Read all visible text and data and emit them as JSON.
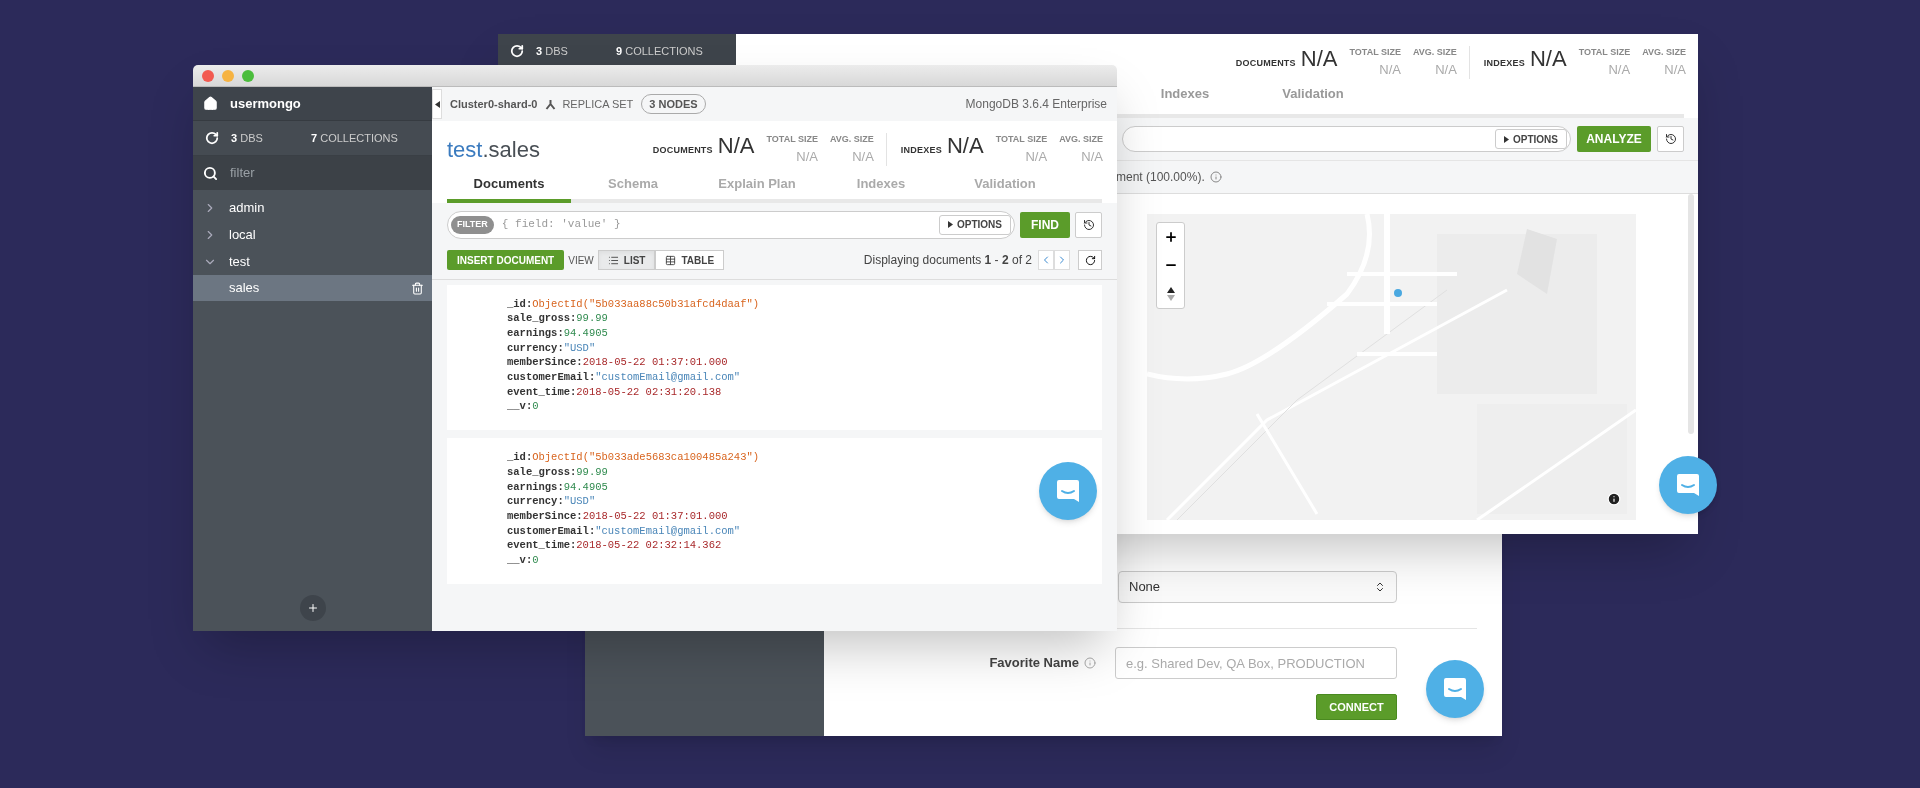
{
  "connect_window": {
    "select": {
      "value": "None"
    },
    "favorite_name": {
      "label": "Favorite Name",
      "placeholder": "e.g. Shared Dev, QA Box, PRODUCTION"
    },
    "connect_button": "CONNECT"
  },
  "stores_window": {
    "sidebar": {
      "dbs": {
        "count": "3",
        "label": "DBS"
      },
      "collections": {
        "count": "9",
        "label": "COLLECTIONS"
      }
    },
    "stats": [
      {
        "label": "DOCUMENTS",
        "value": "N/A",
        "sub": [
          {
            "label": "TOTAL SIZE",
            "value": "N/A"
          },
          {
            "label": "AVG. SIZE",
            "value": "N/A"
          }
        ]
      },
      {
        "label": "INDEXES",
        "value": "N/A",
        "sub": [
          {
            "label": "TOTAL SIZE",
            "value": "N/A"
          },
          {
            "label": "AVG. SIZE",
            "value": "N/A"
          }
        ]
      }
    ],
    "tabs": [
      {
        "label": "Indexes",
        "selected": false
      },
      {
        "label": "Validation",
        "selected": false
      }
    ],
    "options_button": "OPTIONS",
    "analyze_button": "ANALYZE",
    "message": "ment (100.00%)."
  },
  "sales_window": {
    "sidebar": {
      "connection": "usermongo",
      "dbs": {
        "count": "3",
        "label": "DBS"
      },
      "collections": {
        "count": "7",
        "label": "COLLECTIONS"
      },
      "filter_placeholder": "filter",
      "databases": [
        {
          "name": "admin",
          "expanded": false
        },
        {
          "name": "local",
          "expanded": false
        },
        {
          "name": "test",
          "expanded": true,
          "children": [
            {
              "name": "sales",
              "selected": true
            }
          ]
        }
      ]
    },
    "topbar": {
      "cluster": "Cluster0-shard-0",
      "replica_label": "REPLICA SET",
      "nodes": "3 NODES",
      "version": "MongoDB 3.6.4 Enterprise"
    },
    "title": {
      "db": "test",
      "collection": ".sales"
    },
    "stats": [
      {
        "label": "DOCUMENTS",
        "value": "N/A",
        "sub": [
          {
            "label": "TOTAL SIZE",
            "value": "N/A"
          },
          {
            "label": "AVG. SIZE",
            "value": "N/A"
          }
        ]
      },
      {
        "label": "INDEXES",
        "value": "N/A",
        "sub": [
          {
            "label": "TOTAL SIZE",
            "value": "N/A"
          },
          {
            "label": "AVG. SIZE",
            "value": "N/A"
          }
        ]
      }
    ],
    "tabs": [
      {
        "label": "Documents",
        "selected": true
      },
      {
        "label": "Schema",
        "selected": false
      },
      {
        "label": "Explain Plan",
        "selected": false
      },
      {
        "label": "Indexes",
        "selected": false
      },
      {
        "label": "Validation",
        "selected": false
      }
    ],
    "filter": {
      "badge": "FILTER",
      "placeholder": "{ field: 'value' }"
    },
    "options_button": "OPTIONS",
    "find_button": "FIND",
    "insert_button": "INSERT DOCUMENT",
    "view_label": "VIEW",
    "view_options": [
      {
        "label": "LIST",
        "kind": "list",
        "selected": true
      },
      {
        "label": "TABLE",
        "kind": "table",
        "selected": false
      }
    ],
    "paging": "Displaying documents **1** - **2** of 2",
    "documents": [
      {
        "fields": [
          {
            "key": "_id:",
            "value": "ObjectId(\"5b033aa88c50b31afcd4daaf\")",
            "kind": "objectid"
          },
          {
            "key": "sale_gross:",
            "value": "99.99",
            "kind": "number"
          },
          {
            "key": "earnings:",
            "value": "94.4905",
            "kind": "number"
          },
          {
            "key": "currency:",
            "value": "\"USD\"",
            "kind": "string"
          },
          {
            "key": "memberSince:",
            "value": "2018-05-22 01:37:01.000",
            "kind": "date"
          },
          {
            "key": "customerEmail:",
            "value": "\"customEmail@gmail.com\"",
            "kind": "string"
          },
          {
            "key": "event_time:",
            "value": "2018-05-22 02:31:20.138",
            "kind": "date"
          },
          {
            "key": "__v:",
            "value": "0",
            "kind": "number"
          }
        ]
      },
      {
        "fields": [
          {
            "key": "_id:",
            "value": "ObjectId(\"5b033ade5683ca100485a243\")",
            "kind": "objectid"
          },
          {
            "key": "sale_gross:",
            "value": "99.99",
            "kind": "number"
          },
          {
            "key": "earnings:",
            "value": "94.4905",
            "kind": "number"
          },
          {
            "key": "currency:",
            "value": "\"USD\"",
            "kind": "string"
          },
          {
            "key": "memberSince:",
            "value": "2018-05-22 01:37:01.000",
            "kind": "date"
          },
          {
            "key": "customerEmail:",
            "value": "\"customEmail@gmail.com\"",
            "kind": "string"
          },
          {
            "key": "event_time:",
            "value": "2018-05-22 02:32:14.362",
            "kind": "date"
          },
          {
            "key": "__v:",
            "value": "0",
            "kind": "number"
          }
        ]
      }
    ]
  }
}
